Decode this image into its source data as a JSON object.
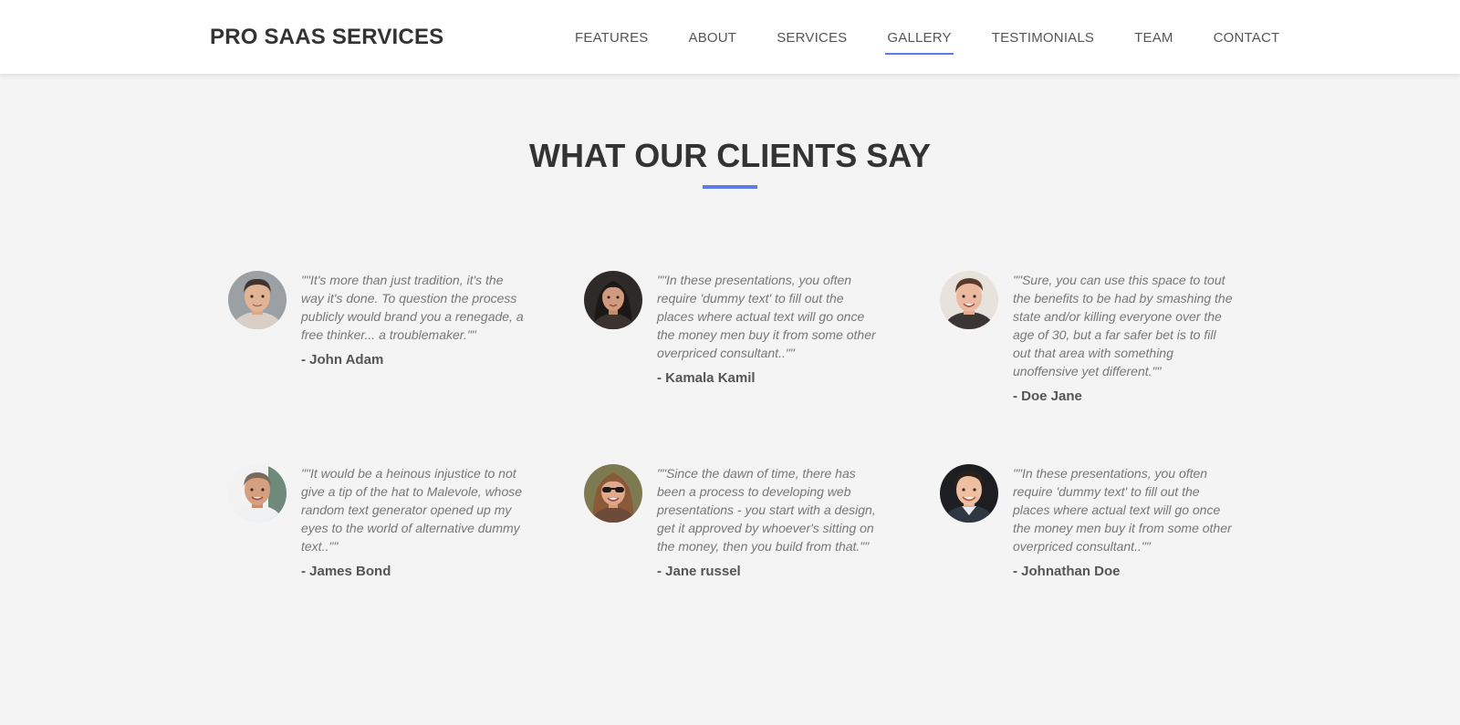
{
  "header": {
    "brand": "PRO SAAS SERVICES",
    "nav": [
      {
        "label": "FEATURES",
        "active": false
      },
      {
        "label": "ABOUT",
        "active": false
      },
      {
        "label": "SERVICES",
        "active": false
      },
      {
        "label": "GALLERY",
        "active": true
      },
      {
        "label": "TESTIMONIALS",
        "active": false
      },
      {
        "label": "TEAM",
        "active": false
      },
      {
        "label": "CONTACT",
        "active": false
      }
    ]
  },
  "section": {
    "title": "WHAT OUR CLIENTS SAY",
    "accent_color": "#5c7de6"
  },
  "testimonials": [
    {
      "quote": "\"\"It's more than just tradition, it's the way it's done. To question the process publicly would brand you a renegade, a free thinker... a troublemaker.\"\"",
      "author": "- John Adam",
      "avatar_icon": "man-portrait"
    },
    {
      "quote": "\"\"In these presentations, you often require 'dummy text' to fill out the places where actual text will go once the money men buy it from some other overpriced consultant..\"\"",
      "author": "- Kamala Kamil",
      "avatar_icon": "woman-portrait"
    },
    {
      "quote": "\"\"Sure, you can use this space to tout the benefits to be had by smashing the state and/or killing everyone over the age of 30, but a far safer bet is to fill out that area with something unoffensive yet different.\"\"",
      "author": "- Doe Jane",
      "avatar_icon": "young-man-portrait"
    },
    {
      "quote": "\"\"It would be a heinous injustice to not give a tip of the hat to Malevole, whose random text generator opened up my eyes to the world of alternative dummy text..\"\"",
      "author": "- James Bond",
      "avatar_icon": "older-man-portrait"
    },
    {
      "quote": "\"\"Since the dawn of time, there has been a process to developing web presentations - you start with a design, get it approved by whoever's sitting on the money, then you build from that.\"\"",
      "author": "- Jane russel",
      "avatar_icon": "woman-sunglasses-portrait"
    },
    {
      "quote": "\"\"In these presentations, you often require 'dummy text' to fill out the places where actual text will go once the money men buy it from some other overpriced consultant..\"\"",
      "author": "- Johnathan Doe",
      "avatar_icon": "young-man-smiling-portrait"
    }
  ]
}
